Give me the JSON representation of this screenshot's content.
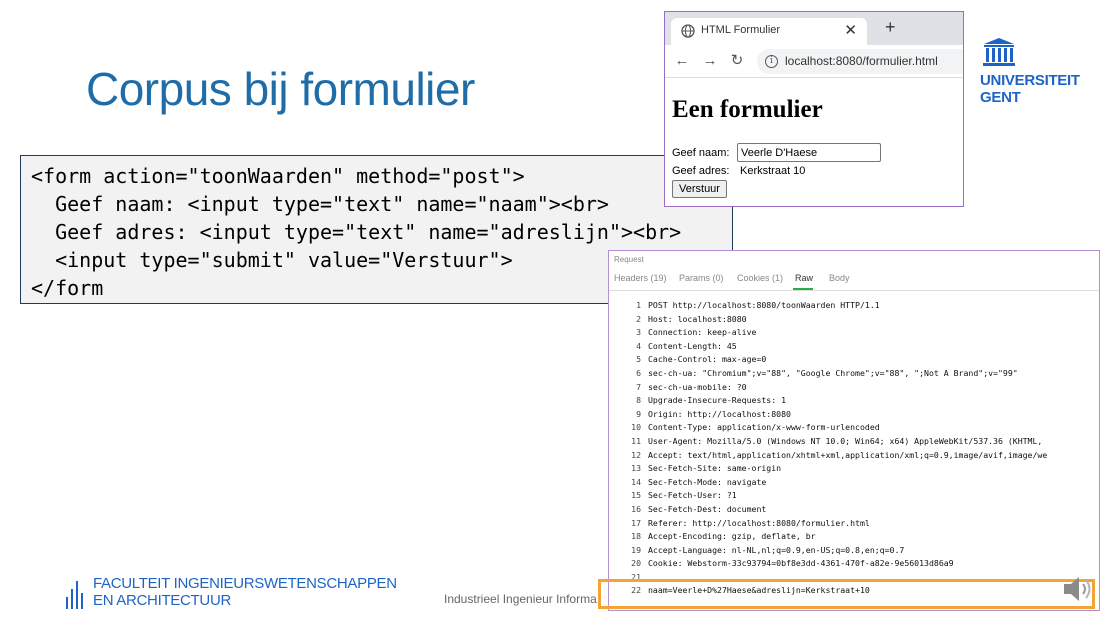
{
  "slide": {
    "title": "Corpus bij formulier",
    "code_lines": [
      "<form action=\"toonWaarden\" method=\"post\">",
      "  Geef naam: <input type=\"text\" name=\"naam\"><br>",
      "  Geef adres: <input type=\"text\" name=\"adreslijn\"><br>",
      "  <input type=\"submit\" value=\"Verstuur\">",
      "</form"
    ],
    "footer": "Industrieel Ingenieur Informa"
  },
  "browser": {
    "tab_title": "HTML Formulier",
    "tab_close": "✕",
    "new_tab": "+",
    "back": "←",
    "forward": "→",
    "reload": "↻",
    "url": "localhost:8080/formulier.html",
    "page_heading": "Een formulier",
    "naam_label": "Geef naam:",
    "naam_value": "Veerle D'Haese",
    "adres_label": "Geef adres:",
    "adres_value": "Kerkstraat 10",
    "submit_label": "Verstuur"
  },
  "logo": {
    "line1": "UNIVERSITEIT",
    "line2": "GENT"
  },
  "faculty": {
    "line1": "FACULTEIT INGENIEURSWETENSCHAPPEN",
    "line2": "EN ARCHITECTUUR"
  },
  "request_panel": {
    "title": "Request",
    "tabs": [
      "Headers (19)",
      "Params (0)",
      "Cookies (1)",
      "Raw",
      "Body"
    ],
    "active_tab": "Raw",
    "lines": [
      {
        "n": "1",
        "text": "POST http://localhost:8080/toonWaarden HTTP/1.1"
      },
      {
        "n": "2",
        "text": "Host: localhost:8080"
      },
      {
        "n": "3",
        "text": "Connection: keep-alive"
      },
      {
        "n": "4",
        "text": "Content-Length: 45"
      },
      {
        "n": "5",
        "text": "Cache-Control: max-age=0"
      },
      {
        "n": "6",
        "text": "sec-ch-ua: \"Chromium\";v=\"88\", \"Google Chrome\";v=\"88\", \";Not A Brand\";v=\"99\""
      },
      {
        "n": "7",
        "text": "sec-ch-ua-mobile: ?0"
      },
      {
        "n": "8",
        "text": "Upgrade-Insecure-Requests: 1"
      },
      {
        "n": "9",
        "text": "Origin: http://localhost:8080"
      },
      {
        "n": "10",
        "text": "Content-Type: application/x-www-form-urlencoded"
      },
      {
        "n": "11",
        "text": "User-Agent: Mozilla/5.0 (Windows NT 10.0; Win64; x64) AppleWebKit/537.36 (KHTML,"
      },
      {
        "n": "12",
        "text": "Accept: text/html,application/xhtml+xml,application/xml;q=0.9,image/avif,image/we"
      },
      {
        "n": "13",
        "text": "Sec-Fetch-Site: same-origin"
      },
      {
        "n": "14",
        "text": "Sec-Fetch-Mode: navigate"
      },
      {
        "n": "15",
        "text": "Sec-Fetch-User: ?1"
      },
      {
        "n": "16",
        "text": "Sec-Fetch-Dest: document"
      },
      {
        "n": "17",
        "text": "Referer: http://localhost:8080/formulier.html"
      },
      {
        "n": "18",
        "text": "Accept-Encoding: gzip, deflate, br"
      },
      {
        "n": "19",
        "text": "Accept-Language: nl-NL,nl;q=0.9,en-US;q=0.8,en;q=0.7"
      },
      {
        "n": "20",
        "text": "Cookie: Webstorm-33c93794=0bf8e3dd-4361-470f-a82e-9e56013d86a9"
      },
      {
        "n": "21",
        "text": ""
      },
      {
        "n": "22",
        "text": "naam=Veerle+D%27Haese&adreslijn=Kerkstraat+10"
      }
    ]
  },
  "colors": {
    "title": "#1f6da8",
    "brand": "#1e64c8",
    "highlight": "#f4a432",
    "raw_tab_underline": "#2bb03f"
  }
}
